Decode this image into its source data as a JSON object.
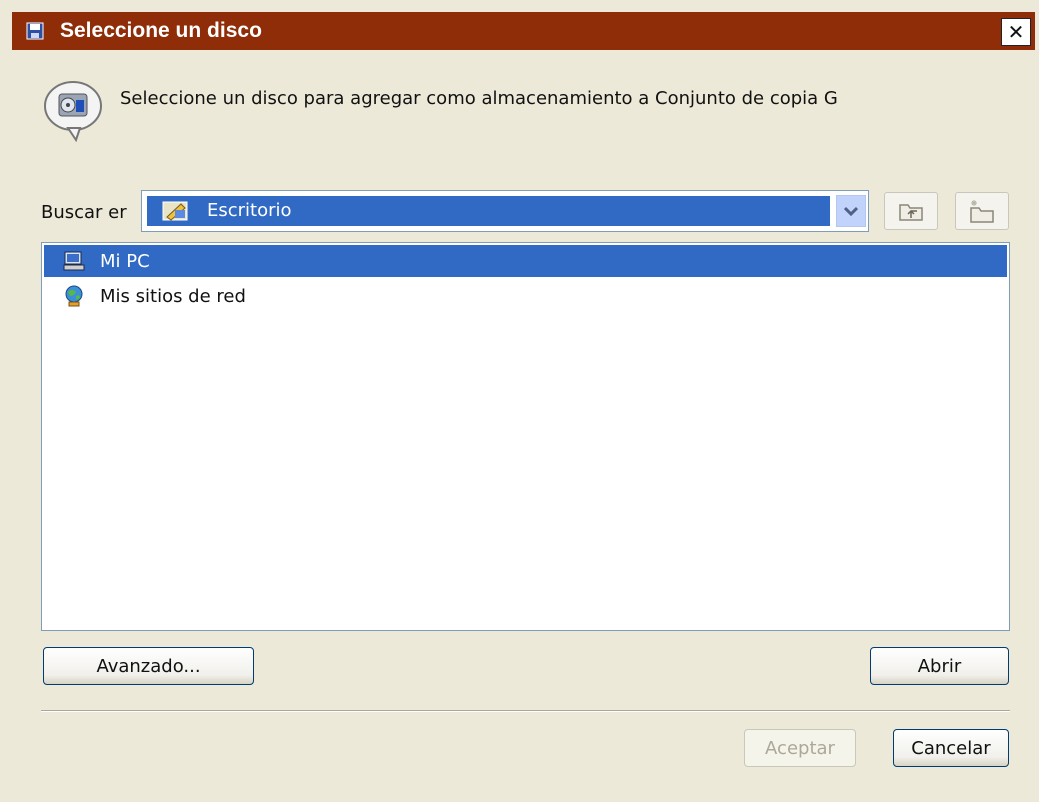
{
  "window": {
    "title": "Seleccione un disco",
    "close_glyph": "✕"
  },
  "prompt": {
    "text": "Seleccione un disco para agregar como almacenamiento a Conjunto de copia G"
  },
  "look_in": {
    "label": "Buscar er",
    "selected": "Escritorio"
  },
  "list": {
    "items": [
      {
        "label": "Mi PC",
        "icon": "computer-icon",
        "selected": true
      },
      {
        "label": "Mis sitios de red",
        "icon": "network-places-icon",
        "selected": false
      }
    ]
  },
  "buttons": {
    "advanced": "Avanzado...",
    "open": "Abrir",
    "accept": "Aceptar",
    "cancel": "Cancelar"
  },
  "colors": {
    "titlebar": "#8f2d08",
    "selection": "#316ac5",
    "dialog": "#ece9d8"
  }
}
